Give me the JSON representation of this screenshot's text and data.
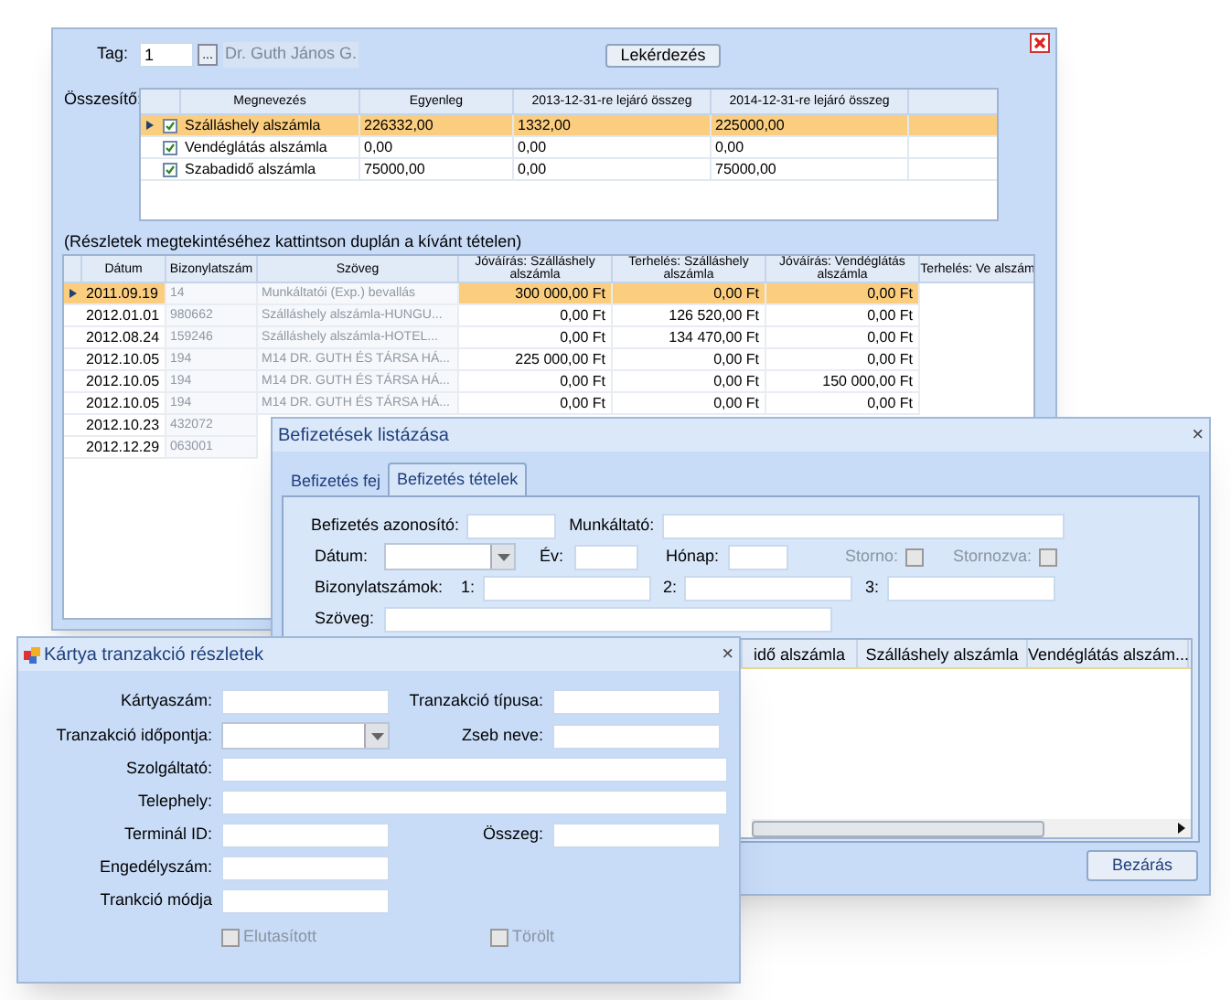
{
  "main_window": {
    "tag_label": "Tag:",
    "tag_value": "1",
    "browse_button": "...",
    "member_name": "Dr. Guth János G.",
    "query_button": "Lekérdezés",
    "summary_label": "Összesítő:",
    "summary_columns": [
      "Megnevezés",
      "Egyenleg",
      "2013-12-31-re lejáró összeg",
      "2014-12-31-re lejáró összeg"
    ],
    "summary_rows": [
      {
        "selected": true,
        "checked": true,
        "cells": [
          "Szálláshely alszámla",
          "226332,00",
          "1332,00",
          "225000,00"
        ]
      },
      {
        "selected": false,
        "checked": true,
        "cells": [
          "Vendéglátás alszámla",
          "0,00",
          "0,00",
          "0,00"
        ]
      },
      {
        "selected": false,
        "checked": true,
        "cells": [
          "Szabadidő alszámla",
          "75000,00",
          "0,00",
          "75000,00"
        ]
      }
    ],
    "hint": "(Részletek megtekintéséhez  kattintson duplán a kívánt tételen)",
    "details_columns": [
      "Dátum",
      "Bizonylatszám",
      "Szöveg",
      "Jóváírás: Szálláshely alszámla",
      "Terhelés: Szálláshely alszámla",
      "Jóváírás: Vendéglátás alszámla",
      "Terhelés: Ve alszám"
    ],
    "details_rows": [
      {
        "selected": true,
        "cells": [
          "2011.09.19",
          "14",
          "Munkáltatói (Exp.) bevallás",
          "300 000,00 Ft",
          "0,00 Ft",
          "0,00 Ft"
        ]
      },
      {
        "selected": false,
        "cells": [
          "2012.01.01",
          "980662",
          "Szálláshely alszámla-HUNGU...",
          "0,00 Ft",
          "126 520,00 Ft",
          "0,00 Ft"
        ]
      },
      {
        "selected": false,
        "cells": [
          "2012.08.24",
          "159246",
          "Szálláshely alszámla-HOTEL...",
          "0,00 Ft",
          "134 470,00 Ft",
          "0,00 Ft"
        ]
      },
      {
        "selected": false,
        "cells": [
          "2012.10.05",
          "194",
          "M14 DR. GUTH ÉS TÁRSA HÁ...",
          "225 000,00 Ft",
          "0,00 Ft",
          "0,00 Ft"
        ]
      },
      {
        "selected": false,
        "cells": [
          "2012.10.05",
          "194",
          "M14 DR. GUTH ÉS TÁRSA HÁ...",
          "0,00 Ft",
          "0,00 Ft",
          "150 000,00 Ft"
        ]
      },
      {
        "selected": false,
        "cells": [
          "2012.10.05",
          "194",
          "M14 DR. GUTH ÉS TÁRSA HÁ...",
          "0,00 Ft",
          "0,00 Ft",
          "0,00 Ft"
        ]
      },
      {
        "selected": false,
        "cells": [
          "2012.10.23",
          "432072"
        ]
      },
      {
        "selected": false,
        "cells": [
          "2012.12.29",
          "063001"
        ]
      }
    ]
  },
  "payments_window": {
    "title": "Befizetések listázása",
    "close": "×",
    "tabs": [
      {
        "label": "Befizetés fej",
        "selected": false
      },
      {
        "label": "Befizetés tételek",
        "selected": true
      }
    ],
    "payment_id_label": "Befizetés azonosító:",
    "employer_label": "Munkáltató:",
    "date_label": "Dátum:",
    "year_label": "Év:",
    "month_label": "Hónap:",
    "flags": [
      {
        "label": "Storno:",
        "checked": false,
        "disabled": true
      },
      {
        "label": "Stornozva:",
        "checked": false,
        "disabled": true
      }
    ],
    "doc_numbers_label": "Bizonylatszámok:",
    "doc_number_labels": [
      "1:",
      "2:",
      "3:"
    ],
    "text_label": "Szöveg:",
    "grid_columns": [
      "idő alszámla",
      "Szálláshely alszámla",
      "Vendéglátás alszám..."
    ],
    "close_button": "Bezárás"
  },
  "card_window": {
    "title": "Kártya tranzakció részletek",
    "close": "×",
    "card_number_label": "Kártyaszám:",
    "transaction_type_label": "Tranzakció típusa:",
    "transaction_time_label": "Tranzakció időpontja:",
    "pocket_label": "Zseb neve:",
    "provider_label": "Szolgáltató:",
    "site_label": "Telephely:",
    "terminal_label": "Terminál ID:",
    "amount_label": "Összeg:",
    "auth_label": "Engedélyszám:",
    "mode_label": "Trankció módja",
    "flags": [
      {
        "label": "Elutasított",
        "checked": false,
        "disabled": true
      },
      {
        "label": "Törölt",
        "checked": false,
        "disabled": true
      }
    ]
  }
}
